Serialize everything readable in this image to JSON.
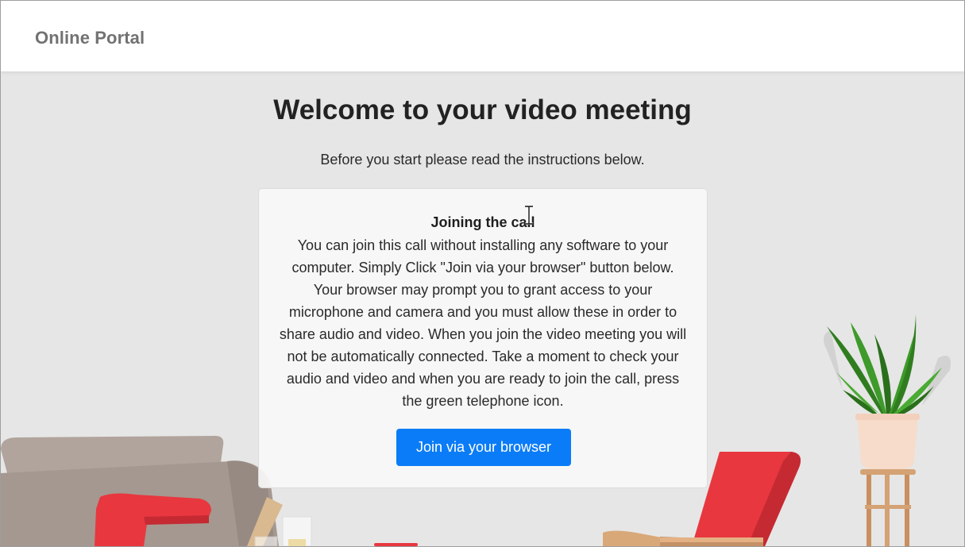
{
  "header": {
    "brand": "Online Portal"
  },
  "main": {
    "title": "Welcome to your video meeting",
    "subtitle": "Before you start please read the instructions below."
  },
  "card": {
    "title": "Joining the call",
    "body": "You can join this call without installing any software to your computer. Simply Click \"Join via your browser\" button below. Your browser may prompt you to grant access to your microphone and camera and you must allow these in order to share audio and video. When you join the video meeting you will not be automatically connected. Take a moment to check your audio and video and when you are ready to join the call, press the green telephone icon.",
    "button_label": "Join via your browser"
  },
  "colors": {
    "background": "#e6e6e6",
    "header_bg": "#ffffff",
    "primary_button": "#0b7cf7",
    "chair_red": "#e8373f",
    "sofa_taupe": "#a89a92",
    "plant_green": "#2f7d1f"
  },
  "icons": [
    "text-cursor-icon"
  ]
}
